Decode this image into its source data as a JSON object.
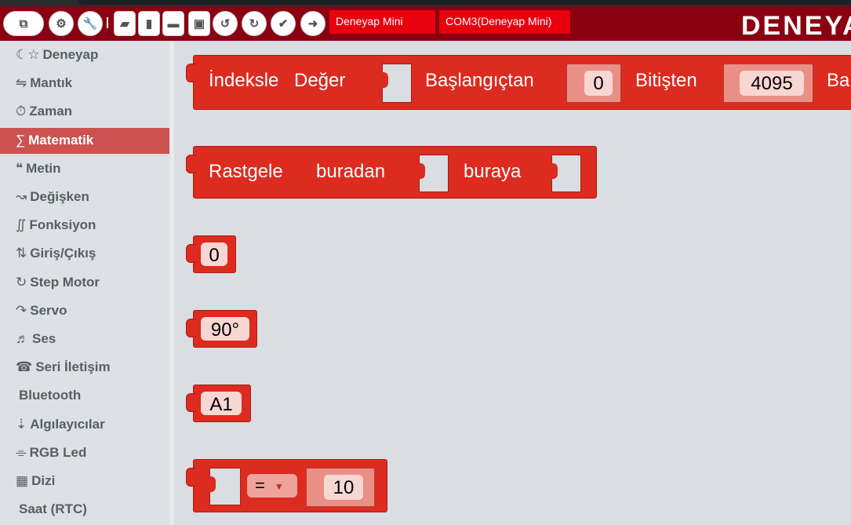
{
  "toolbar": {
    "items": [
      {
        "name": "blocks-toggle",
        "icon": "puzzle-icon"
      },
      {
        "name": "settings",
        "icon": "gear-icon"
      },
      {
        "name": "tools",
        "icon": "wrench-icon"
      },
      {
        "name": "examples",
        "icon": "book-icon"
      },
      {
        "name": "new-file",
        "icon": "file-icon"
      },
      {
        "name": "open",
        "icon": "folder-open-icon"
      },
      {
        "name": "save",
        "icon": "floppy-icon"
      },
      {
        "name": "undo",
        "icon": "undo-icon"
      },
      {
        "name": "redo",
        "icon": "redo-icon"
      },
      {
        "name": "verify",
        "icon": "check-icon"
      },
      {
        "name": "upload",
        "icon": "arrow-right-icon"
      }
    ],
    "board_select": "Deneyap Mini",
    "port_select": "COM3(Deneyap Mini)",
    "logo": "DENEYAP",
    "accent": "#8a0012"
  },
  "sidebar": {
    "items": [
      {
        "icon": "☾☆",
        "label": "Deneyap"
      },
      {
        "icon": "⇋",
        "label": "Mantık"
      },
      {
        "icon": "⏱",
        "label": "Zaman"
      },
      {
        "icon": "∑",
        "label": "Matematik",
        "active": true
      },
      {
        "icon": "❝",
        "label": "Metin"
      },
      {
        "icon": "↝",
        "label": "Değişken"
      },
      {
        "icon": "∬",
        "label": "Fonksiyon"
      },
      {
        "icon": "⇅",
        "label": "Giriş/Çıkış"
      },
      {
        "icon": "↻",
        "label": "Step Motor"
      },
      {
        "icon": "↷",
        "label": "Servo"
      },
      {
        "icon": "♬",
        "label": "Ses"
      },
      {
        "icon": "☎",
        "label": "Seri İletişim"
      },
      {
        "icon": "",
        "label": "Bluetooth"
      },
      {
        "icon": "⇣",
        "label": "Algılayıcılar"
      },
      {
        "icon": "⌯",
        "label": "RGB Led"
      },
      {
        "icon": "▦",
        "label": "Dizi"
      },
      {
        "icon": "",
        "label": "Saat (RTC)"
      }
    ]
  },
  "blocks": {
    "map": {
      "label1": "İndeksle",
      "label2": "Değer",
      "label3": "Başlangıçtan",
      "from": "0",
      "label4": "Bitişten",
      "to": "4095",
      "label5": "Ba"
    },
    "random": {
      "label1": "Rastgele",
      "label2": "buradan",
      "label3": "buraya"
    },
    "number": "0",
    "angle": "90°",
    "pin": "A1",
    "compare": {
      "op": "=",
      "value": "10"
    },
    "color": "#dd2b1f"
  }
}
